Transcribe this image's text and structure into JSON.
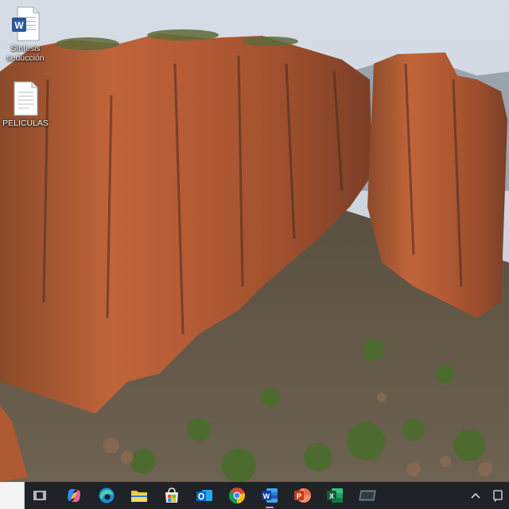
{
  "desktop": {
    "icons": [
      {
        "name": "sintesis-seduccion",
        "label": "Síntesis seducción",
        "type": "word-document"
      },
      {
        "name": "peliculas",
        "label": "PELICULAS",
        "type": "text-document"
      }
    ]
  },
  "taskbar": {
    "icons": [
      {
        "name": "task-view-icon"
      },
      {
        "name": "copilot-icon"
      },
      {
        "name": "edge-icon"
      },
      {
        "name": "file-explorer-icon"
      },
      {
        "name": "microsoft-store-icon"
      },
      {
        "name": "outlook-icon"
      },
      {
        "name": "chrome-icon"
      },
      {
        "name": "word-icon"
      },
      {
        "name": "powerpoint-icon"
      },
      {
        "name": "excel-icon"
      },
      {
        "name": "app-window-icon"
      }
    ],
    "tray": {
      "icons": [
        {
          "name": "chevron-up-icon"
        },
        {
          "name": "notification-icon"
        }
      ]
    }
  },
  "colors": {
    "taskbar_bg": "#1f2227",
    "word_blue": "#2b579a",
    "excel_green": "#217346",
    "powerpoint_orange": "#d24726"
  }
}
